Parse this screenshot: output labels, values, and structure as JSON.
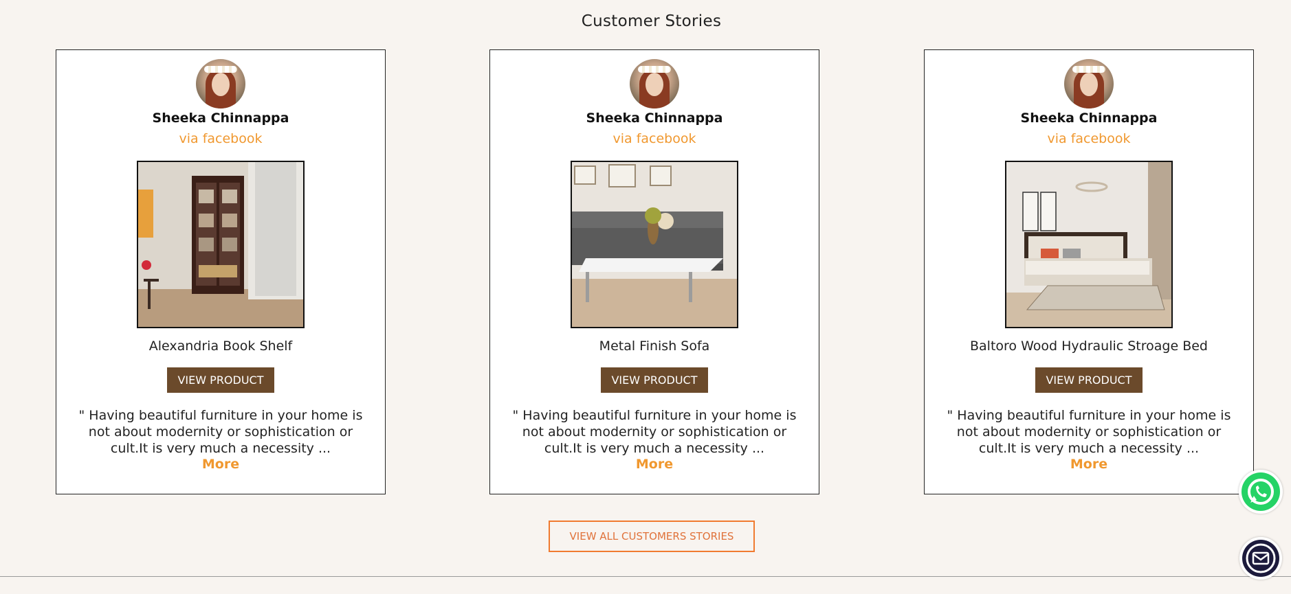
{
  "section": {
    "title": "Customer Stories"
  },
  "stories": [
    {
      "customer_name": "Sheeka Chinnappa",
      "source": "via facebook",
      "product_name": "Alexandria Book Shelf",
      "button_label": "VIEW PRODUCT",
      "quote": "\" Having beautiful furniture in your home is not about modernity or sophistication or cult.It is very much a necessity ...",
      "more_label": "More"
    },
    {
      "customer_name": "Sheeka Chinnappa",
      "source": "via facebook",
      "product_name": "Metal Finish Sofa",
      "button_label": "VIEW PRODUCT",
      "quote": "\" Having beautiful furniture in your home is not about modernity or sophistication or cult.It is very much a necessity ...",
      "more_label": "More"
    },
    {
      "customer_name": "Sheeka Chinnappa",
      "source": "via facebook",
      "product_name": "Baltoro Wood Hydraulic Stroage Bed",
      "button_label": "VIEW PRODUCT",
      "quote": "\" Having beautiful furniture in your home is not about modernity or sophistication or cult.It is very much a necessity ...",
      "more_label": "More"
    }
  ],
  "view_all_label": "VIEW ALL CUSTOMERS STORIES",
  "floating": {
    "whatsapp_icon": "whatsapp-icon",
    "chat_icon": "chat-mail-icon"
  },
  "colors": {
    "background": "#f8f4f0",
    "accent_orange": "#f0982f",
    "button_brown": "#6b4a2b",
    "outline_orange": "#f07a2f",
    "whatsapp_green": "#25d366",
    "chat_navy": "#1c1a3c"
  }
}
